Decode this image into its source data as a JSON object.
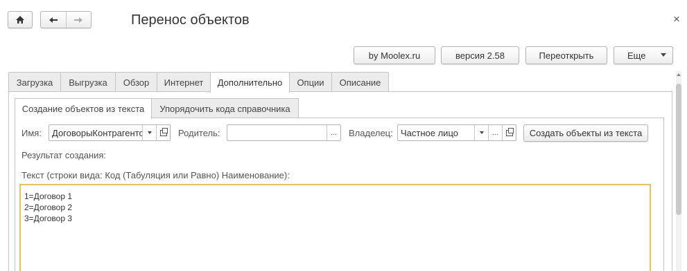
{
  "window": {
    "title": "Перенос объектов",
    "close": "×"
  },
  "nav": {
    "home": "home-icon",
    "back": "arrow-left-icon",
    "forward": "arrow-right-icon"
  },
  "header_buttons": {
    "moolex": "by Moolex.ru",
    "version": "версия 2.58",
    "reopen": "Переоткрыть",
    "more": "Еще"
  },
  "tabs": [
    {
      "label": "Загрузка",
      "active": false
    },
    {
      "label": "Выгрузка",
      "active": false
    },
    {
      "label": "Обзор",
      "active": false
    },
    {
      "label": "Интернет",
      "active": false
    },
    {
      "label": "Дополнительно",
      "active": true
    },
    {
      "label": "Опции",
      "active": false
    },
    {
      "label": "Описание",
      "active": false
    }
  ],
  "subtabs": [
    {
      "label": "Создание объектов из текста",
      "active": true
    },
    {
      "label": "Упорядочить кода справочника",
      "active": false
    }
  ],
  "form": {
    "name_label": "Имя:",
    "name_value": "ДоговорыКонтрагентов",
    "parent_label": "Родитель:",
    "parent_value": "",
    "owner_label": "Владелец:",
    "owner_value": "Частное лицо",
    "ellipsis": "...",
    "create_button": "Создать объекты из текста",
    "result_label": "Результат создания:",
    "text_label": "Текст (строки вида: Код (Табуляция или Равно) Наименование):"
  },
  "text_lines": [
    "1=Договор 1",
    "2=Договор 2",
    "3=Договор 3"
  ],
  "colors": {
    "focus_border": "#f2c14a",
    "tab_inactive": "#ececec",
    "border": "#c4c4c4"
  }
}
